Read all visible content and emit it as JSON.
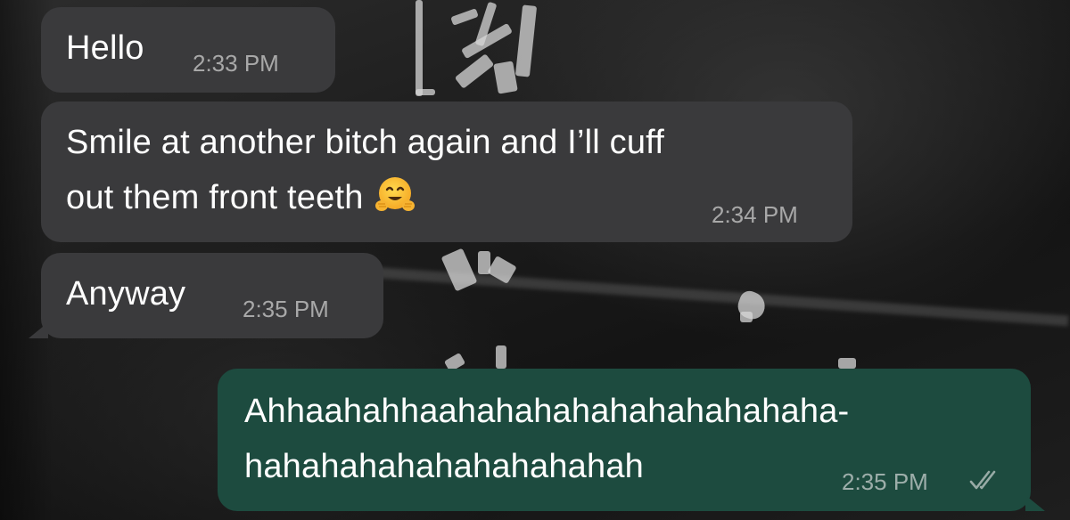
{
  "messages": [
    {
      "direction": "incoming",
      "text": "Hello",
      "time": "2:33 PM"
    },
    {
      "direction": "incoming",
      "text_line1": "Smile at another bitch again and I’ll cuff",
      "text_line2": "out them front teeth",
      "emoji": "hugging-face",
      "time": "2:34 PM"
    },
    {
      "direction": "incoming",
      "text": "Anyway",
      "time": "2:35 PM"
    },
    {
      "direction": "outgoing",
      "text_line1": "Ahhaahahhaahahahahahahahahahaha-",
      "text_line2": "hahahahahahahahahahah",
      "time": "2:35 PM",
      "status": "read"
    }
  ],
  "colors": {
    "incoming_bubble": "#3a3a3c",
    "outgoing_bubble": "#1d4b3f",
    "text": "#ffffff",
    "timestamp": "#a8a8a8"
  }
}
